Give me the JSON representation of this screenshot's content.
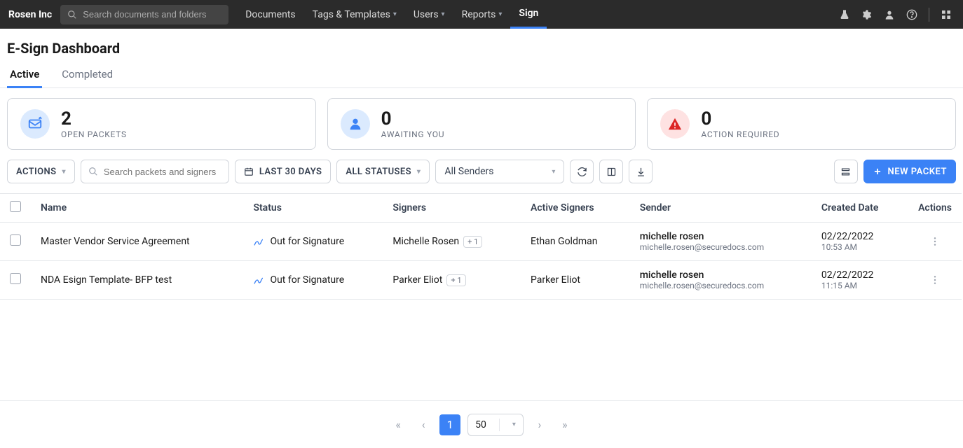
{
  "brand": "Rosen Inc",
  "search_placeholder": "Search documents and folders",
  "nav": {
    "items": [
      "Documents",
      "Tags & Templates",
      "Users",
      "Reports",
      "Sign"
    ],
    "active_index": 4
  },
  "page_title": "E-Sign Dashboard",
  "tabs": {
    "active": "Active",
    "completed": "Completed"
  },
  "stats": {
    "open_packets": {
      "value": "2",
      "label": "OPEN PACKETS"
    },
    "awaiting_you": {
      "value": "0",
      "label": "AWAITING YOU"
    },
    "action_required": {
      "value": "0",
      "label": "ACTION REQUIRED"
    }
  },
  "toolbar": {
    "actions_label": "ACTIONS",
    "search_placeholder": "Search packets and signers",
    "date_filter": "LAST 30 DAYS",
    "status_filter": "ALL STATUSES",
    "sender_filter": "All Senders",
    "new_packet": "NEW PACKET"
  },
  "columns": {
    "name": "Name",
    "status": "Status",
    "signers": "Signers",
    "active_signers": "Active Signers",
    "sender": "Sender",
    "created_date": "Created Date",
    "actions": "Actions"
  },
  "rows": [
    {
      "name": "Master Vendor Service Agreement",
      "status": "Out for Signature",
      "signer": "Michelle Rosen",
      "signer_extra": "+ 1",
      "active_signer": "Ethan Goldman",
      "sender_name": "michelle rosen",
      "sender_email": "michelle.rosen@securedocs.com",
      "date": "02/22/2022",
      "time": "10:53 AM"
    },
    {
      "name": "NDA Esign Template- BFP test",
      "status": "Out for Signature",
      "signer": "Parker Eliot",
      "signer_extra": "+ 1",
      "active_signer": "Parker Eliot",
      "sender_name": "michelle rosen",
      "sender_email": "michelle.rosen@securedocs.com",
      "date": "02/22/2022",
      "time": "11:15 AM"
    }
  ],
  "pagination": {
    "page": "1",
    "page_size": "50"
  }
}
